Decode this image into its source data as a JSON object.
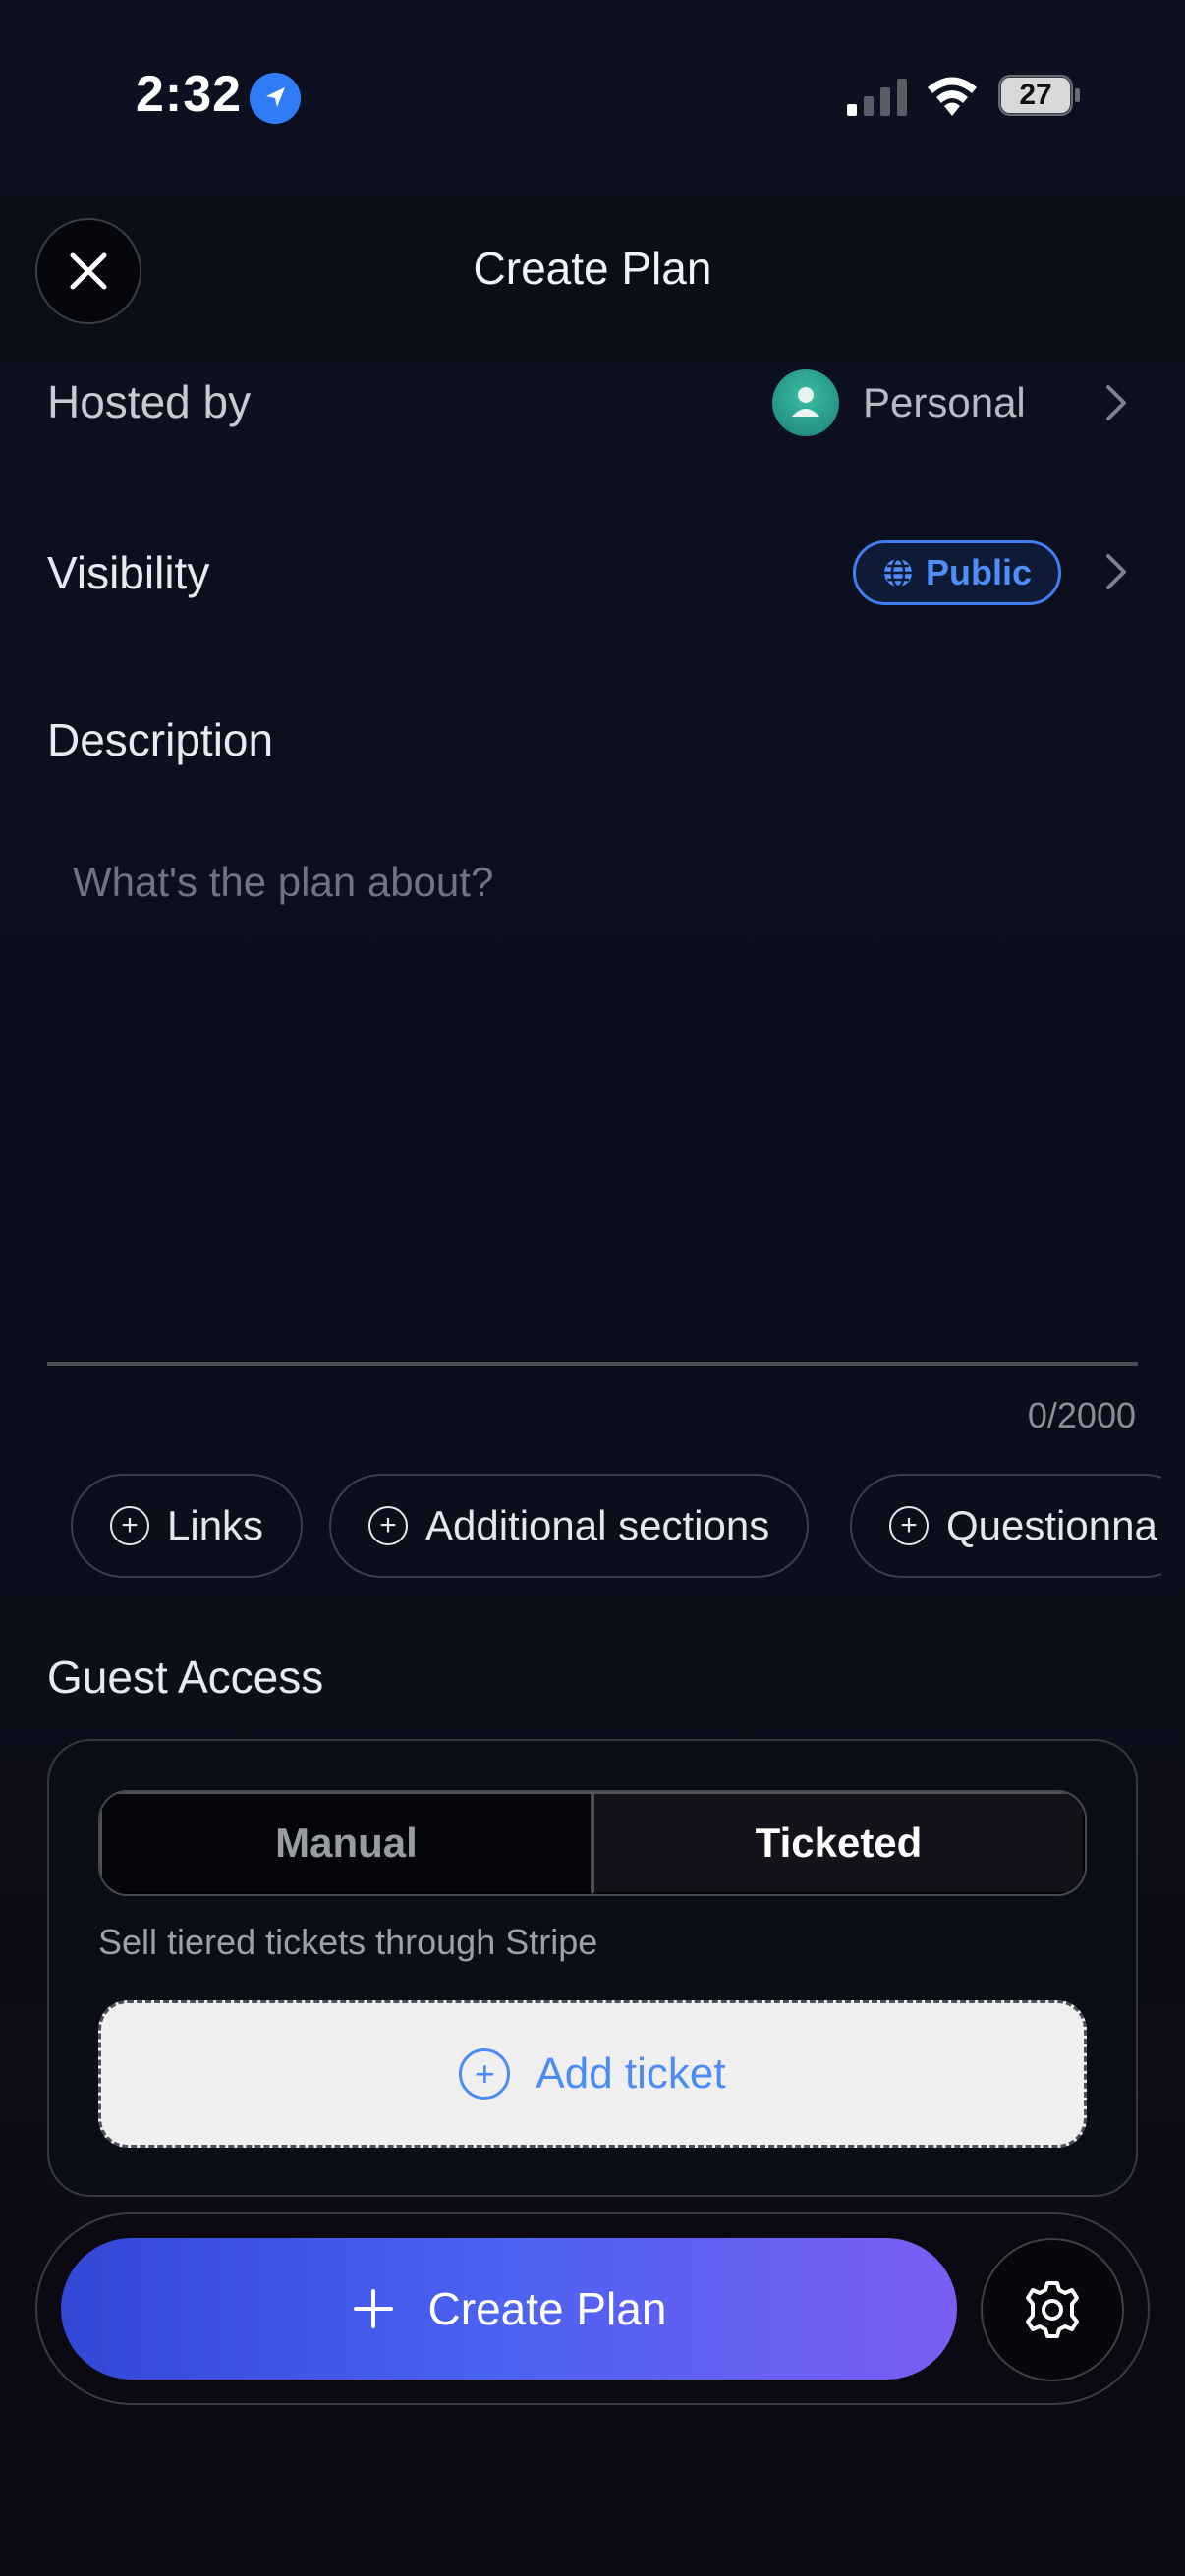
{
  "status_bar": {
    "time": "2:32",
    "battery": "27"
  },
  "header": {
    "title": "Create Plan"
  },
  "hosted_by": {
    "label": "Hosted by",
    "value": "Personal"
  },
  "visibility": {
    "label": "Visibility",
    "value": "Public"
  },
  "description": {
    "label": "Description",
    "placeholder": "What's the plan about?",
    "counter": "0/2000"
  },
  "chips": [
    {
      "label": "Links"
    },
    {
      "label": "Additional sections"
    },
    {
      "label": "Questionna"
    }
  ],
  "guest_access": {
    "label": "Guest Access",
    "options": [
      "Manual",
      "Ticketed"
    ],
    "selected": "Ticketed",
    "hint": "Sell tiered tickets through Stripe",
    "add_ticket": "Add ticket"
  },
  "footer": {
    "create_label": "Create Plan"
  },
  "colors": {
    "accent": "#4b8bf6",
    "gradient_start": "#3348d6",
    "gradient_end": "#7b5ef4",
    "avatar": "#2fa594"
  },
  "icons": [
    "location-arrow-icon",
    "signal-icon",
    "wifi-icon",
    "battery-icon",
    "close-icon",
    "avatar-icon",
    "chevron-right-icon",
    "globe-icon",
    "plus-circle-icon",
    "plus-icon",
    "gear-icon"
  ]
}
